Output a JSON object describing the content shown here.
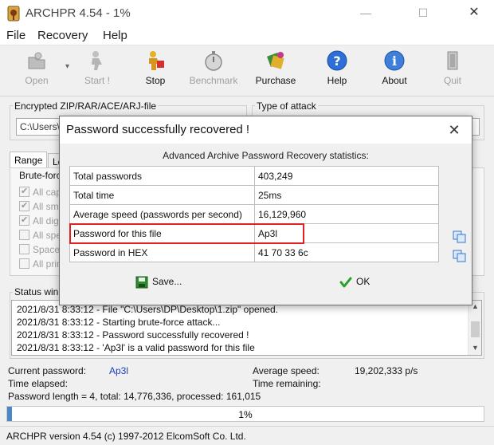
{
  "window": {
    "title": "ARCHPR 4.54 - 1%",
    "minimize": "—",
    "maximize": "☐",
    "close": "✕"
  },
  "menu": [
    "File",
    "Recovery",
    "Help"
  ],
  "toolbar": {
    "open": "Open",
    "start": "Start !",
    "stop": "Stop",
    "benchmark": "Benchmark",
    "purchase": "Purchase",
    "help": "Help",
    "about": "About",
    "quit": "Quit"
  },
  "file_panel": {
    "label": "Encrypted ZIP/RAR/ACE/ARJ-file",
    "path": "C:\\Users\\"
  },
  "attack_panel": {
    "label": "Type of attack"
  },
  "tabs": {
    "range": "Range",
    "length": "Le"
  },
  "brute_force": {
    "label": "Brute-forc",
    "options": [
      {
        "label": "All cap",
        "checked": true
      },
      {
        "label": "All sma",
        "checked": true
      },
      {
        "label": "All dig",
        "checked": true
      },
      {
        "label": "All spe",
        "checked": false
      },
      {
        "label": "Space",
        "checked": false
      },
      {
        "label": "All prin",
        "checked": false
      }
    ]
  },
  "status": {
    "label": "Status win",
    "log": [
      "2021/8/31 8:33:12 - File \"C:\\Users\\DP\\Desktop\\1.zip\" opened.",
      "2021/8/31 8:33:12 - Starting brute-force attack...",
      "2021/8/31 8:33:12 - Password successfully recovered !",
      "2021/8/31 8:33:12 - 'Ap3l' is a valid password for this file"
    ]
  },
  "info": {
    "current_password_label": "Current password:",
    "current_password": "Ap3l",
    "time_elapsed_label": "Time elapsed:",
    "avg_speed_label": "Average speed:",
    "avg_speed": "19,202,333 p/s",
    "time_remaining_label": "Time remaining:",
    "length_line": "Password length = 4, total: 14,776,336, processed: 161,015"
  },
  "progress": {
    "value": 0.01,
    "text": "1%"
  },
  "footer": "ARCHPR version 4.54 (c) 1997-2012 ElcomSoft Co. Ltd.",
  "dialog": {
    "title": "Password successfully recovered !",
    "close": "✕",
    "subtitle": "Advanced Archive Password Recovery statistics:",
    "rows": [
      {
        "key": "Total passwords",
        "value": "403,249"
      },
      {
        "key": "Total time",
        "value": "25ms"
      },
      {
        "key": "Average speed (passwords per second)",
        "value": "16,129,960"
      },
      {
        "key": "Password for this file",
        "value": "Ap3l"
      },
      {
        "key": "Password in HEX",
        "value": "41 70 33 6c"
      }
    ],
    "save": "Save...",
    "ok": "OK"
  },
  "colors": {
    "highlight": "#e02020",
    "link_blue": "#1a3fbd",
    "progress_fill": "#4a86c8"
  }
}
